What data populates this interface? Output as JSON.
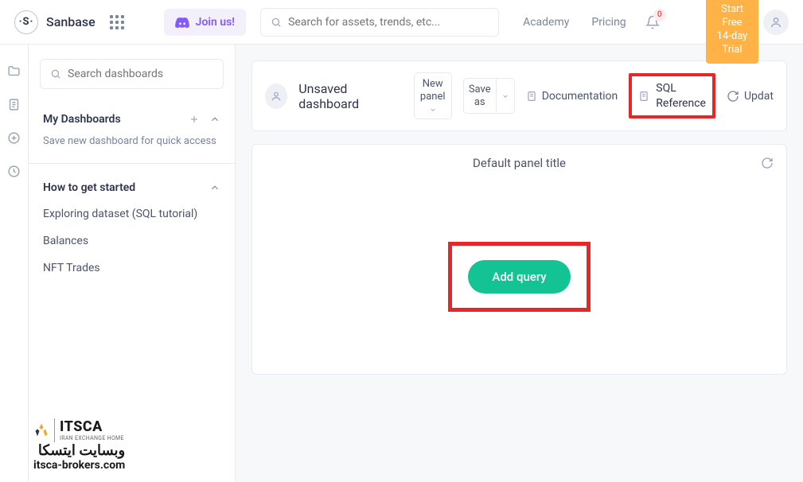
{
  "header": {
    "brand": "Sanbase",
    "logo_text": "·S·",
    "join_label": "Join us!",
    "search_placeholder": "Search for assets, trends, etc...",
    "nav": {
      "academy": "Academy",
      "pricing": "Pricing"
    },
    "notifications_count": "0",
    "trial_text": "Start Free 14-day Trial"
  },
  "sidebar": {
    "search_placeholder": "Search dashboards",
    "my_dashboards": {
      "title": "My Dashboards",
      "desc": "Save new dashboard for quick access"
    },
    "how_to": {
      "title": "How to get started",
      "items": [
        "Exploring dataset (SQL tutorial)",
        "Balances",
        "NFT Trades"
      ]
    }
  },
  "toolbar": {
    "title": "Unsaved dashboard",
    "new_panel": "New panel",
    "save_as": "Save as",
    "documentation": "Documentation",
    "sql_reference_l1": "SQL",
    "sql_reference_l2": "Reference",
    "update": "Updat"
  },
  "panel": {
    "title": "Default panel title",
    "add_query": "Add query"
  },
  "watermark": {
    "brand": "ITSCA",
    "sub": "IRAN EXCHANGE HOME",
    "line2": "وبسایت ایتسکا",
    "line3": "itsca-brokers.com"
  }
}
